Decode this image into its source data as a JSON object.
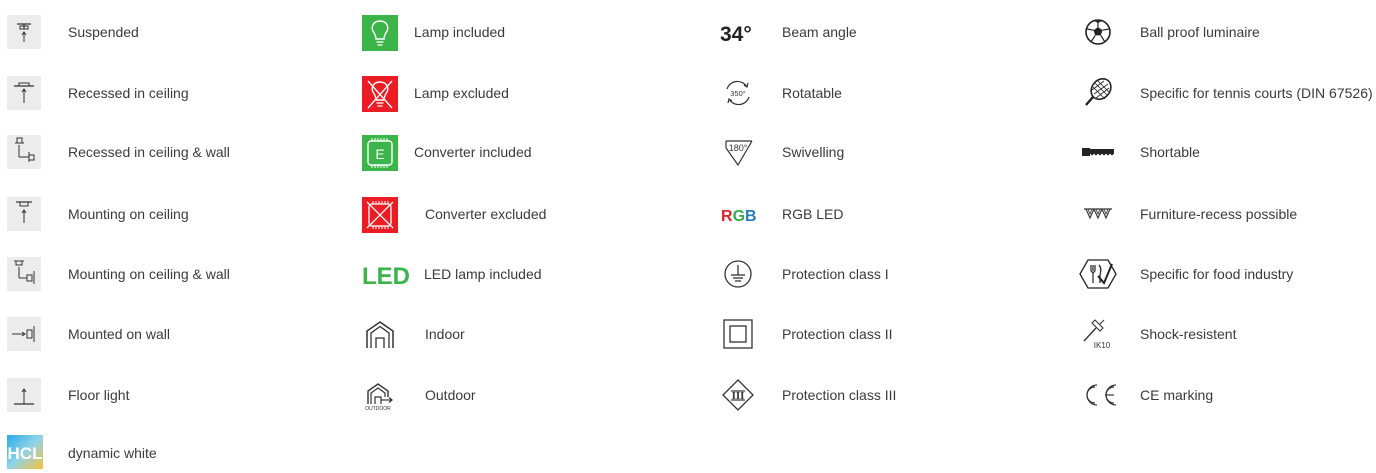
{
  "columns": [
    {
      "items": [
        {
          "label": "Suspended",
          "icon": "suspended-icon"
        },
        {
          "label": "Recessed in ceiling",
          "icon": "recessed-ceiling-icon"
        },
        {
          "label": "Recessed in ceiling & wall",
          "icon": "recessed-ceiling-wall-icon"
        },
        {
          "label": "Mounting on ceiling",
          "icon": "mounting-ceiling-icon"
        },
        {
          "label": "Mounting on ceiling & wall",
          "icon": "mounting-ceiling-wall-icon"
        },
        {
          "label": "Mounted on wall",
          "icon": "mounted-wall-icon"
        },
        {
          "label": "Floor light",
          "icon": "floor-light-icon"
        },
        {
          "label": "dynamic white",
          "icon": "hcl-icon",
          "icon_text": "HCL"
        }
      ]
    },
    {
      "items": [
        {
          "label": "Lamp included",
          "icon": "lamp-included-icon"
        },
        {
          "label": "Lamp excluded",
          "icon": "lamp-excluded-icon"
        },
        {
          "label": "Converter included",
          "icon": "converter-included-icon",
          "icon_text": "E"
        },
        {
          "label": "Converter excluded",
          "icon": "converter-excluded-icon"
        },
        {
          "label": "LED lamp included",
          "icon": "led-icon",
          "icon_text": "LED"
        },
        {
          "label": "Indoor",
          "icon": "indoor-icon"
        },
        {
          "label": "Outdoor",
          "icon": "outdoor-icon",
          "icon_text": "OUTDOOR"
        }
      ]
    },
    {
      "items": [
        {
          "label": "Beam angle",
          "icon": "beam-angle-icon",
          "icon_text": "34°"
        },
        {
          "label": "Rotatable",
          "icon": "rotatable-icon",
          "icon_text": "350°"
        },
        {
          "label": "Swivelling",
          "icon": "swivelling-icon",
          "icon_text": "180°"
        },
        {
          "label": "RGB LED",
          "icon": "rgb-icon",
          "icon_text": "RGB"
        },
        {
          "label": "Protection class I",
          "icon": "protection-class-1-icon"
        },
        {
          "label": "Protection class II",
          "icon": "protection-class-2-icon"
        },
        {
          "label": "Protection class III",
          "icon": "protection-class-3-icon",
          "icon_text": "III"
        }
      ]
    },
    {
      "items": [
        {
          "label": "Ball proof luminaire",
          "icon": "ball-icon"
        },
        {
          "label": "Specific for tennis courts (DIN 67526)",
          "icon": "tennis-racket-icon"
        },
        {
          "label": "Shortable",
          "icon": "saw-icon"
        },
        {
          "label": "Furniture-recess possible",
          "icon": "furniture-recess-icon"
        },
        {
          "label": "Specific for food industry",
          "icon": "food-industry-icon"
        },
        {
          "label": "Shock-resistent",
          "icon": "hammer-icon",
          "icon_text": "IK10"
        },
        {
          "label": "CE marking",
          "icon": "ce-icon",
          "icon_text": "CE"
        }
      ]
    }
  ],
  "colors": {
    "green": "#3bb44a",
    "red": "#ec1c24",
    "led_green": "#39b54a",
    "tile_bg": "#ececec",
    "text": "#3a3a3a",
    "rgb_r": "#e3202a",
    "rgb_g": "#2fae49",
    "rgb_b": "#2a79c2"
  }
}
